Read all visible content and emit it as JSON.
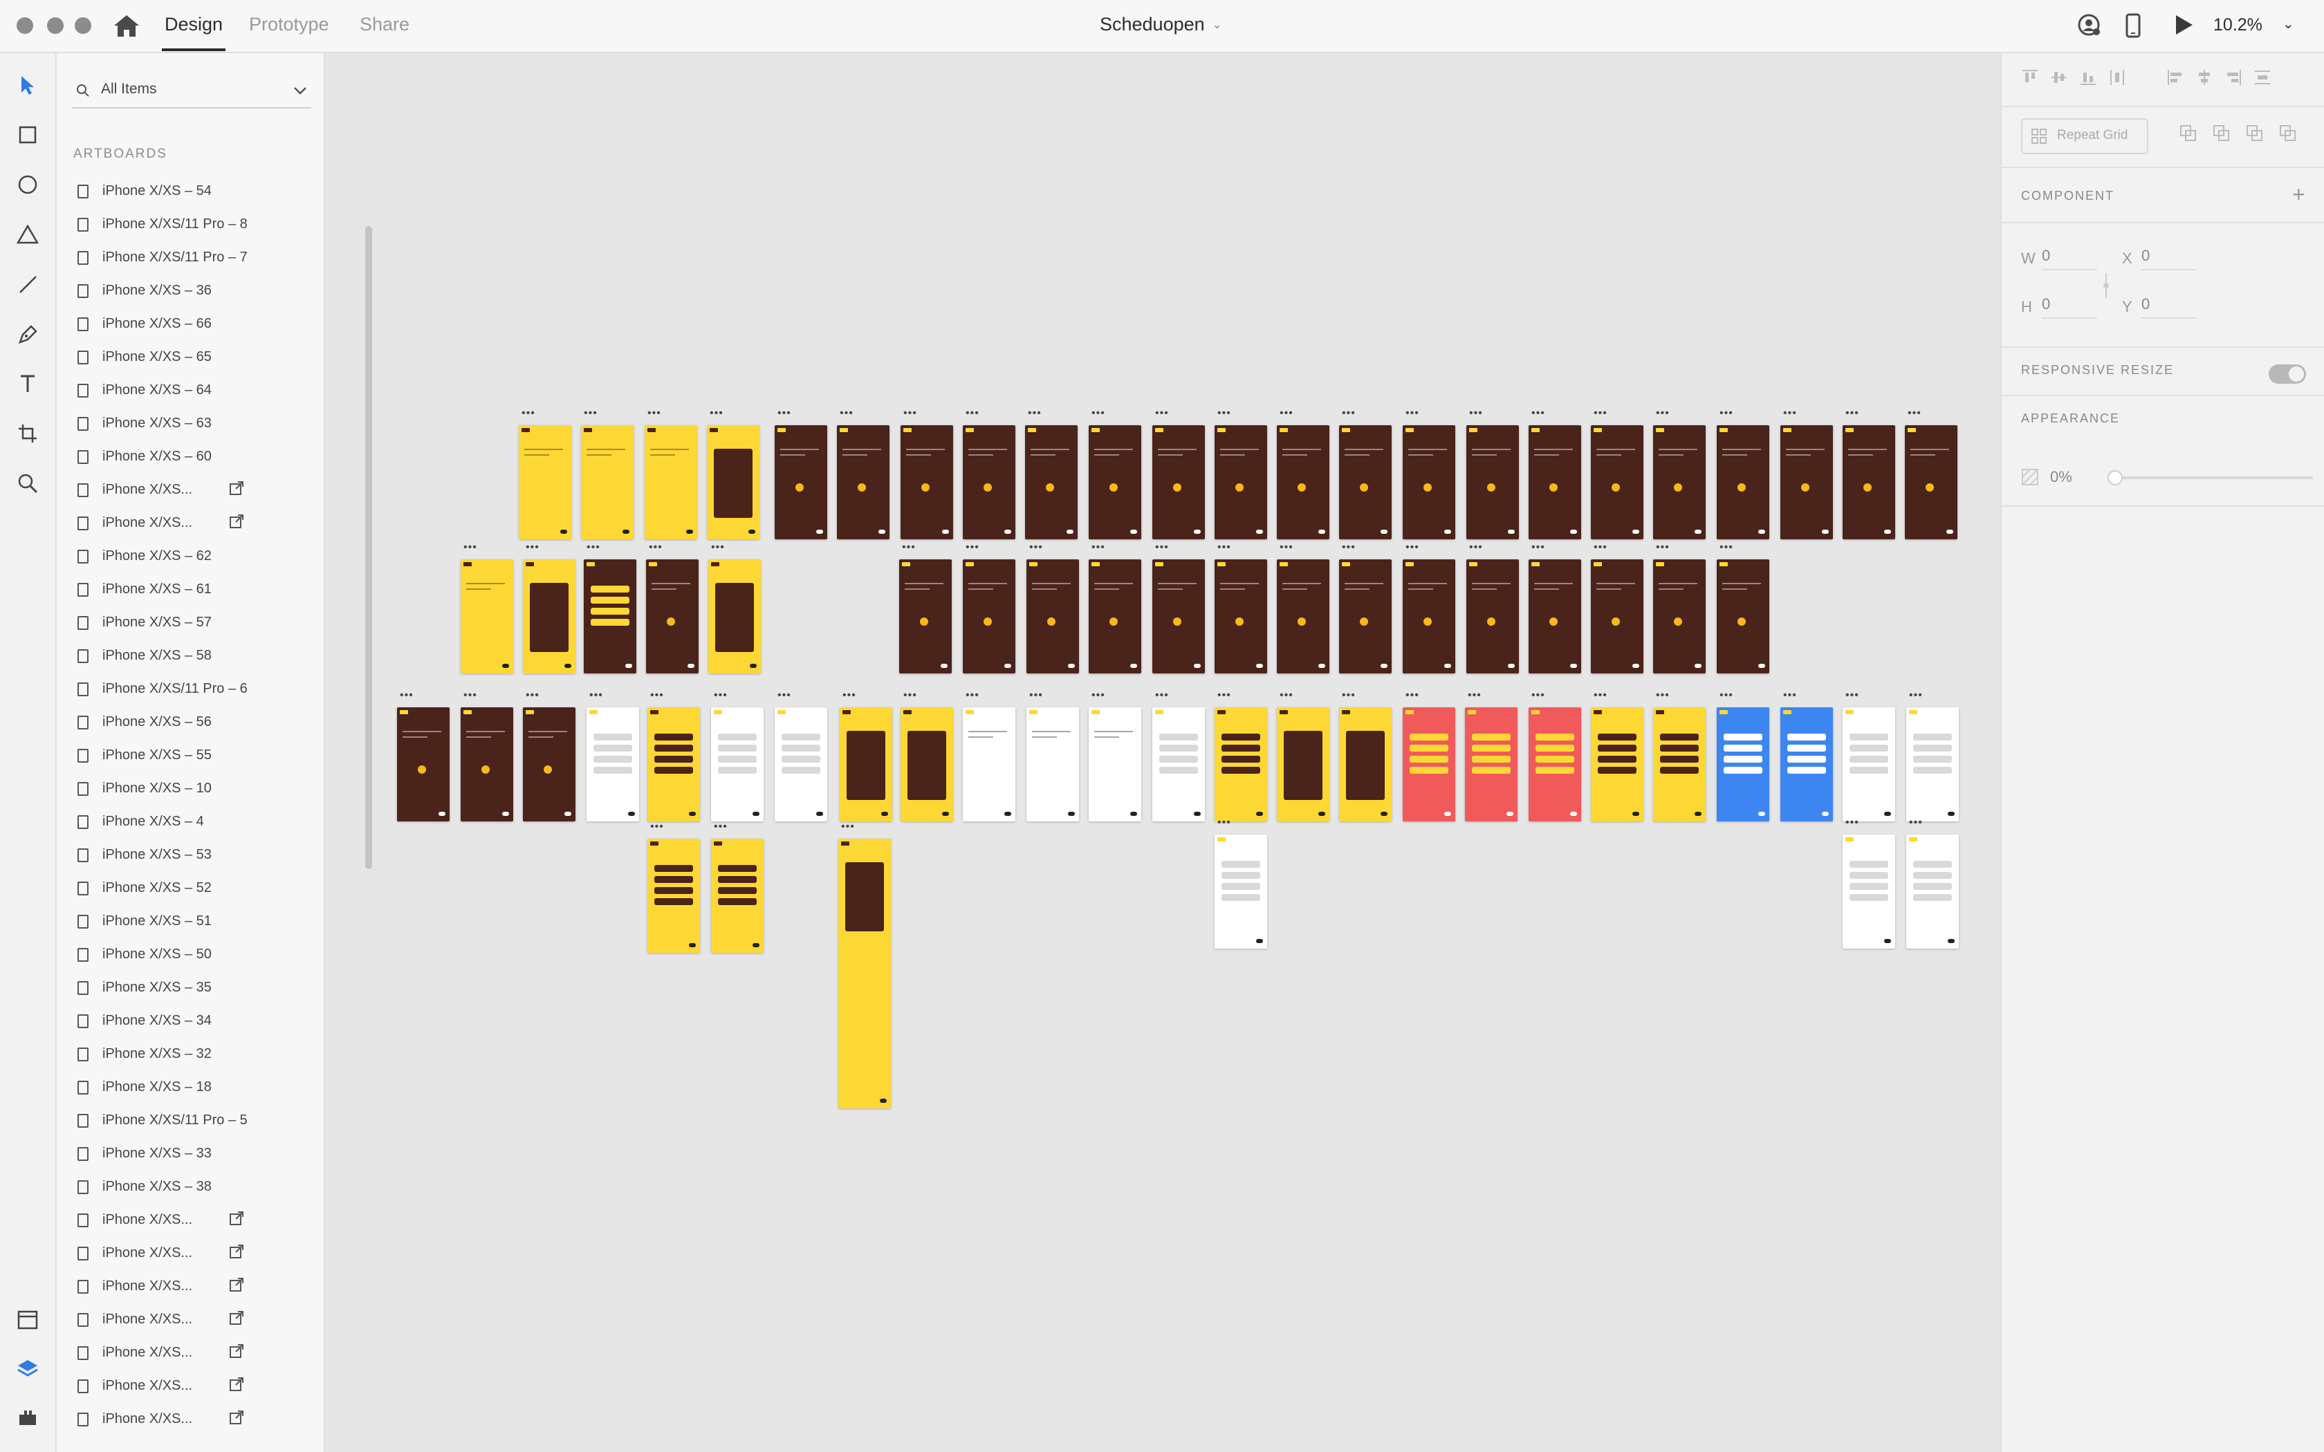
{
  "app": {
    "mode_tabs": [
      "Design",
      "Prototype",
      "Share"
    ],
    "active_tab": "Design",
    "document_title": "Scheduopen",
    "zoom": "10.2%"
  },
  "layers_panel": {
    "search_placeholder": "All Items",
    "section_title": "ARTBOARDS",
    "artboards": [
      "iPhone X/XS – 54",
      "iPhone X/XS/11 Pro – 8",
      "iPhone X/XS/11 Pro – 7",
      "iPhone X/XS – 36",
      "iPhone X/XS – 66",
      "iPhone X/XS – 65",
      "iPhone X/XS – 64",
      "iPhone X/XS – 63",
      "iPhone X/XS – 60",
      "iPhone X/XS...",
      "iPhone X/XS...",
      "iPhone X/XS – 62",
      "iPhone X/XS – 61",
      "iPhone X/XS – 57",
      "iPhone X/XS – 58",
      "iPhone X/XS/11 Pro – 6",
      "iPhone X/XS – 56",
      "iPhone X/XS – 55",
      "iPhone X/XS – 10",
      "iPhone X/XS – 4",
      "iPhone X/XS – 53",
      "iPhone X/XS – 52",
      "iPhone X/XS – 51",
      "iPhone X/XS – 50",
      "iPhone X/XS – 35",
      "iPhone X/XS – 34",
      "iPhone X/XS – 32",
      "iPhone X/XS – 18",
      "iPhone X/XS/11 Pro – 5",
      "iPhone X/XS – 33",
      "iPhone X/XS – 38",
      "iPhone X/XS...",
      "iPhone X/XS...",
      "iPhone X/XS...",
      "iPhone X/XS...",
      "iPhone X/XS...",
      "iPhone X/XS...",
      "iPhone X/XS..."
    ],
    "linked_flags": [
      false,
      false,
      false,
      false,
      false,
      false,
      false,
      false,
      false,
      true,
      true,
      false,
      false,
      false,
      false,
      false,
      false,
      false,
      false,
      false,
      false,
      false,
      false,
      false,
      false,
      false,
      false,
      false,
      false,
      false,
      false,
      true,
      true,
      true,
      true,
      true,
      true,
      true
    ]
  },
  "inspector": {
    "repeat_grid_label": "Repeat Grid",
    "component_label": "COMPONENT",
    "w_label": "W",
    "w_value": "0",
    "x_label": "X",
    "x_value": "0",
    "h_label": "H",
    "h_value": "0",
    "y_label": "Y",
    "y_value": "0",
    "responsive_resize_label": "RESPONSIVE RESIZE",
    "appearance_label": "APPEARANCE",
    "opacity_value": "0%"
  },
  "canvas": {
    "artboard_colors": {
      "brown": "#4a231a",
      "yellow": "#fdd835",
      "red": "#f15a5a",
      "blue": "#3d85f0",
      "white": "#ffffff"
    },
    "background": "#e6e6e6"
  }
}
